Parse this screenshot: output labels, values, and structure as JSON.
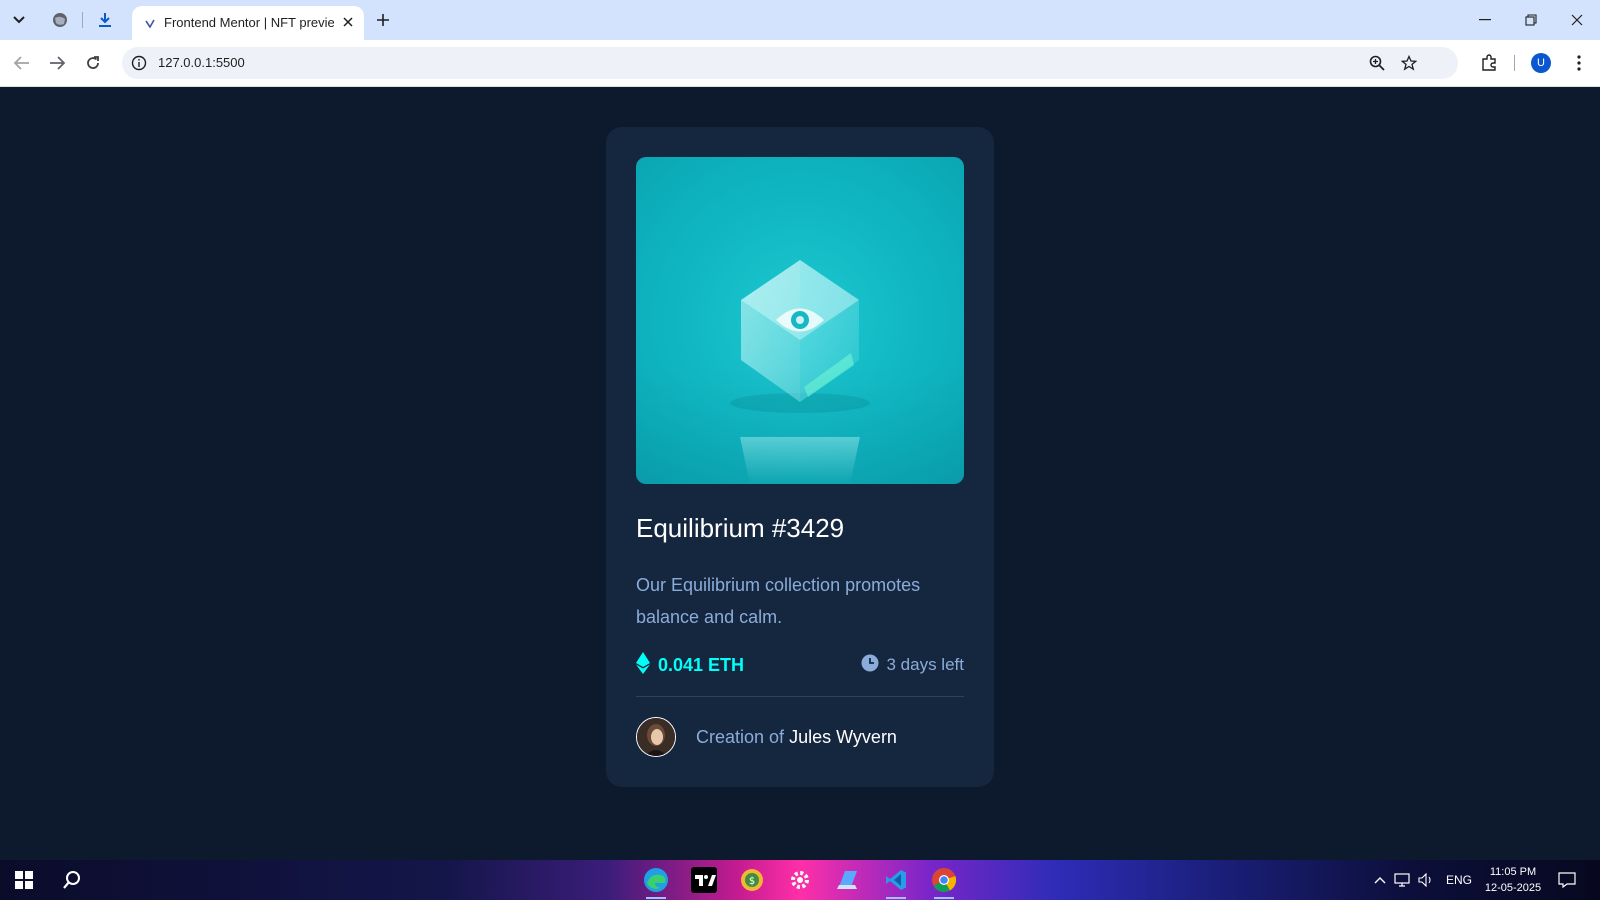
{
  "browser": {
    "tab_title": "Frontend Mentor | NFT preview card component",
    "url": "127.0.0.1:5500",
    "profile_initial": "U"
  },
  "card": {
    "title": "Equilibrium #3429",
    "description": "Our Equilibrium collection promotes balance and calm.",
    "price": "0.041 ETH",
    "time_left": "3 days left",
    "creator_prefix": "Creation of",
    "creator_name": "Jules Wyvern"
  },
  "taskbar": {
    "language": "ENG",
    "time": "11:05 PM",
    "date": "12-05-2025"
  },
  "colors": {
    "page_bg": "#0d192c",
    "card_bg": "#15263f",
    "cyan_accent": "#00fff7",
    "soft_blue": "#8bacd9",
    "image_bg": "#0fb6c2"
  },
  "icons": [
    "tab-search-icon",
    "globe-icon",
    "download-icon",
    "close-icon",
    "plus-icon",
    "minimize-icon",
    "restore-icon",
    "back-icon",
    "forward-icon",
    "reload-icon",
    "info-icon",
    "zoom-icon",
    "star-icon",
    "extensions-icon",
    "menu-icon",
    "ethereum-icon",
    "clock-icon",
    "windows-start-icon",
    "search-icon"
  ]
}
